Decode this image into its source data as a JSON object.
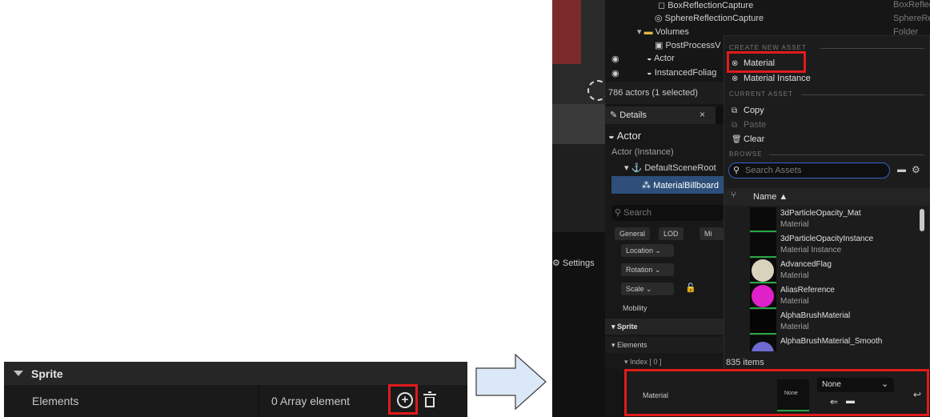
{
  "left_panel": {
    "section_title": "Sprite",
    "elements_label": "Elements",
    "array_count": "0 Array element"
  },
  "right": {
    "outliner": {
      "rows": [
        {
          "name": "BoxReflectionCapture",
          "type": "BoxReflectionCaptur"
        },
        {
          "name": "SphereReflectionCapture",
          "type": "SphereReflectionCa"
        },
        {
          "name": "Volumes",
          "type": "Folder"
        },
        {
          "name": "PostProcessV",
          "type": ""
        },
        {
          "name": "Actor",
          "type": ""
        },
        {
          "name": "InstancedFoliag",
          "type": ""
        }
      ],
      "actor_count": "786 actors (1 selected)"
    },
    "settings_label": "Settings",
    "details_tab": "Details",
    "tab_close": "×",
    "details_title": "Actor",
    "instance_label": "Actor (Instance)",
    "tree": [
      "DefaultSceneRoot",
      "MaterialBillboard"
    ],
    "search_placeholder": "Search",
    "filter_chips": [
      "General",
      "LOD",
      "Mi"
    ],
    "transform": [
      "Location",
      "Rotation",
      "Scale"
    ],
    "mobility_label": "Mobility",
    "sprite_section": "Sprite",
    "elements_section": "Elements",
    "index_label": "Index [ 0 ]",
    "menu": {
      "create_header": "CREATE NEW ASSET",
      "create_items": [
        "Material",
        "Material Instance"
      ],
      "current_header": "CURRENT ASSET",
      "current_items": [
        "Copy",
        "Paste",
        "Clear"
      ],
      "browse_header": "BROWSE",
      "search_placeholder": "Search Assets",
      "column_name": "Name ▲",
      "assets": [
        {
          "name": "3dParticleOpacity_Mat",
          "type": "Material",
          "color": "#1b1b1b"
        },
        {
          "name": "3dParticleOpacityInstance",
          "type": "Material Instance",
          "color": "#1b1b1b"
        },
        {
          "name": "AdvancedFlag",
          "type": "Material",
          "color": "#d9d2bd"
        },
        {
          "name": "AliasReference",
          "type": "Material",
          "color": "#e020c8"
        },
        {
          "name": "AlphaBrushMaterial",
          "type": "Material",
          "color": "#050505"
        },
        {
          "name": "AlphaBrushMaterial_Smooth",
          "type": "",
          "color": "#6d6ad0"
        }
      ],
      "item_count": "835 items"
    },
    "material_row": {
      "label": "Material",
      "thumb_label": "None",
      "dropdown_value": "None"
    }
  },
  "colors": {
    "highlight_red": "#e01b1b",
    "selection_blue": "#2f63c8",
    "arrow_fill": "#dae8f7"
  }
}
